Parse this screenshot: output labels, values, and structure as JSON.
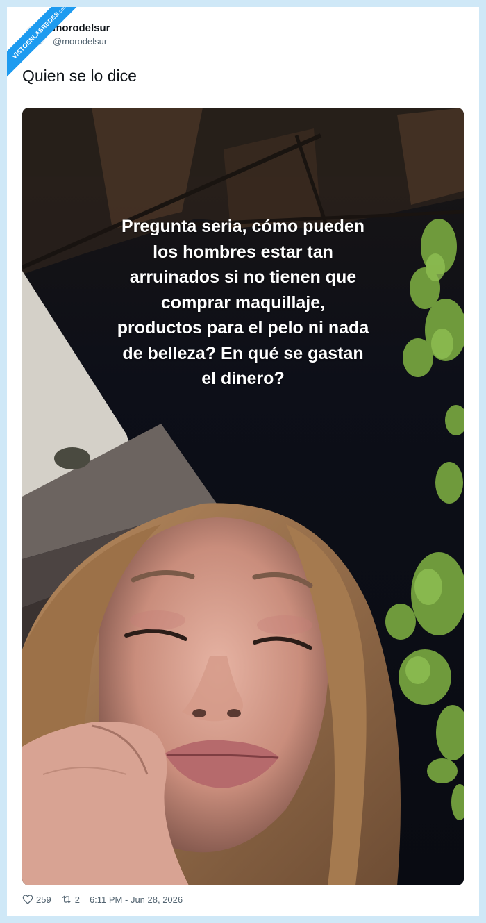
{
  "watermark": {
    "text": "VISTOENLASREDES",
    "suffix": ".com"
  },
  "tweet": {
    "author_name": "morodelsur",
    "author_handle": "@morodelsur",
    "text": "Quien se lo dice",
    "likes": "259",
    "retweets": "2",
    "timestamp": "6:11 PM - Jun 28, 2026"
  },
  "media": {
    "overlay_lines": [
      "Pregunta seria, cómo pueden",
      "los hombres estar tan",
      "arruinados si no tienen que",
      "comprar maquillaje,",
      "productos para el pelo ni nada",
      "de belleza? En qué se gastan",
      "el dinero?"
    ]
  },
  "icons": {
    "like": "heart-icon",
    "retweet": "retweet-icon",
    "avatar": "avatar"
  },
  "colors": {
    "background": "#cfe8f7",
    "card": "#ffffff",
    "accent": "#1d9bf0",
    "text_primary": "#0f1419",
    "text_secondary": "#536471"
  }
}
